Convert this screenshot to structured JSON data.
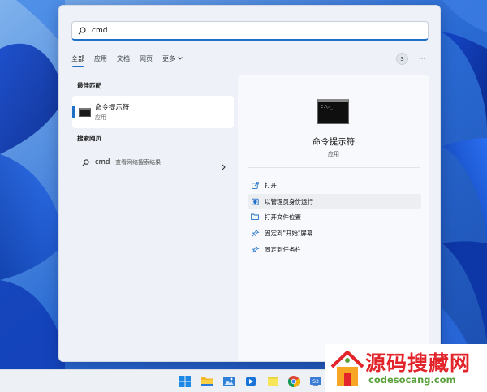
{
  "search": {
    "value": "cmd"
  },
  "filters": {
    "tabs": [
      {
        "label": "全部"
      },
      {
        "label": "应用"
      },
      {
        "label": "文档"
      },
      {
        "label": "网页"
      },
      {
        "label": "更多"
      }
    ],
    "result_count": "3",
    "more_menu": "···"
  },
  "best_match": {
    "heading": "最佳匹配",
    "title": "命令提示符",
    "subtitle": "应用"
  },
  "web": {
    "heading": "搜索网页",
    "query": "cmd",
    "hint": "- 查看网络搜索结果"
  },
  "preview": {
    "app_name": "命令提示符",
    "app_type": "应用",
    "console_prompt": "C:\\>_",
    "actions": [
      {
        "label": "打开",
        "icon": "open-external-icon"
      },
      {
        "label": "以管理员身份运行",
        "icon": "shield-admin-icon"
      },
      {
        "label": "打开文件位置",
        "icon": "folder-icon"
      },
      {
        "label": "固定到\"开始\"屏幕",
        "icon": "pin-icon"
      },
      {
        "label": "固定到任务栏",
        "icon": "pin-icon"
      }
    ]
  },
  "taskbar": {
    "icons": [
      "windows-start-icon",
      "file-explorer-icon",
      "photos-icon",
      "media-player-icon",
      "sticky-notes-icon",
      "chrome-icon",
      "network-icon"
    ]
  },
  "watermark": {
    "title": "源码搜藏网",
    "domain": "codesocang.com"
  },
  "colors": {
    "accent": "#1f6fc7",
    "panel_bg": "#eef2f8",
    "watermark_red": "#e2242b",
    "watermark_green": "#5aa13c"
  }
}
